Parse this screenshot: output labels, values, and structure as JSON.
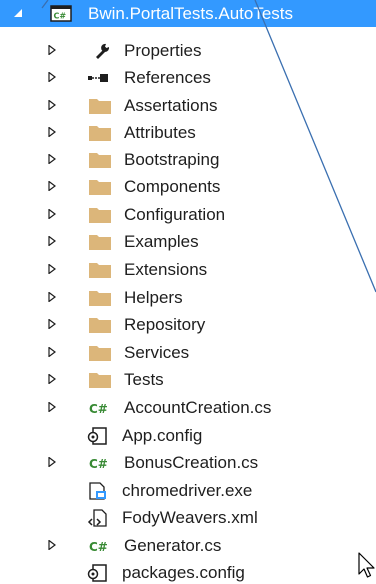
{
  "project": {
    "label": "Bwin.PortalTests.AutoTests",
    "icon": "csharp-project-icon",
    "expanded": true
  },
  "items": [
    {
      "label": "Properties",
      "icon": "wrench-icon",
      "expandable": true
    },
    {
      "label": "References",
      "icon": "references-icon",
      "expandable": true
    },
    {
      "label": "Assertations",
      "icon": "folder-icon",
      "expandable": true
    },
    {
      "label": "Attributes",
      "icon": "folder-icon",
      "expandable": true
    },
    {
      "label": "Bootstraping",
      "icon": "folder-icon",
      "expandable": true
    },
    {
      "label": "Components",
      "icon": "folder-icon",
      "expandable": true
    },
    {
      "label": "Configuration",
      "icon": "folder-icon",
      "expandable": true
    },
    {
      "label": "Examples",
      "icon": "folder-icon",
      "expandable": true
    },
    {
      "label": "Extensions",
      "icon": "folder-icon",
      "expandable": true
    },
    {
      "label": "Helpers",
      "icon": "folder-icon",
      "expandable": true
    },
    {
      "label": "Repository",
      "icon": "folder-icon",
      "expandable": true
    },
    {
      "label": "Services",
      "icon": "folder-icon",
      "expandable": true
    },
    {
      "label": "Tests",
      "icon": "folder-icon",
      "expandable": true
    },
    {
      "label": "AccountCreation.cs",
      "icon": "csharp-file-icon",
      "expandable": true
    },
    {
      "label": "App.config",
      "icon": "config-file-icon",
      "expandable": false
    },
    {
      "label": "BonusCreation.cs",
      "icon": "csharp-file-icon",
      "expandable": true
    },
    {
      "label": "chromedriver.exe",
      "icon": "exe-file-icon",
      "expandable": false
    },
    {
      "label": "FodyWeavers.xml",
      "icon": "xml-file-icon",
      "expandable": false
    },
    {
      "label": "Generator.cs",
      "icon": "csharp-file-icon",
      "expandable": true
    },
    {
      "label": "packages.config",
      "icon": "config-file-icon",
      "expandable": false
    }
  ],
  "colors": {
    "selection": "#3399ff",
    "folder": "#dcb67a",
    "csharp": "#388a34",
    "text": "#1e1e1e",
    "overlay_line": "#3a6fb0"
  }
}
